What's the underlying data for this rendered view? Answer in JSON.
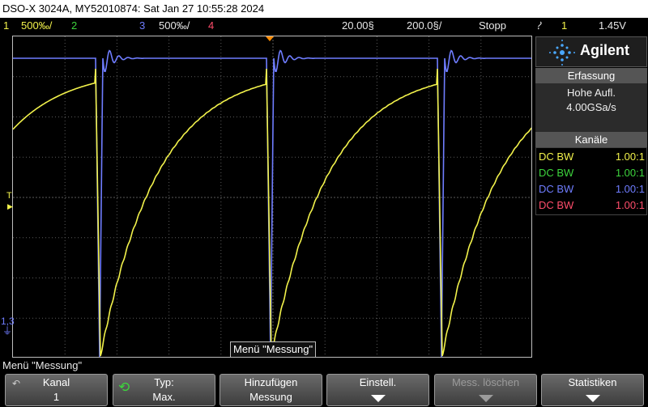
{
  "window": {
    "title": "DSO-X 3024A, MY52010874: Sat Jan 27 10:55:28 2024"
  },
  "status": {
    "ch1_num": "1",
    "ch1_scale": "500‰/",
    "ch2_num": "2",
    "ch3_num": "3",
    "ch3_scale": "500‰/",
    "ch4_num": "4",
    "timebase_delay": "20.00§",
    "timebase_scale": "200.0§/",
    "run_state": "Stopp",
    "trigger_symbol": "⹔",
    "trigger_source": "1",
    "trigger_level": "1.45V"
  },
  "side_panel": {
    "brand": "Agilent",
    "acq_header": "Erfassung",
    "acq_mode": "Hohe Aufl.",
    "acq_rate": "4.00GSa/s",
    "chan_header": "Kanäle",
    "channels": [
      {
        "coupling": "DC BW",
        "ratio": "1.00:1",
        "color": "#f2f24b"
      },
      {
        "coupling": "DC BW",
        "ratio": "1.00:1",
        "color": "#3dd43d"
      },
      {
        "coupling": "DC BW",
        "ratio": "1.00:1",
        "color": "#6f7dff"
      },
      {
        "coupling": "DC BW",
        "ratio": "1.00:1",
        "color": "#ff4d6b"
      }
    ]
  },
  "screen": {
    "trigger_marker": "T",
    "ch_marker": "1,3",
    "menu_overlay": "Menü \"Messung\""
  },
  "message_bar": "Menü \"Messung\"",
  "softkeys": [
    {
      "line1": "Kanal",
      "line2": "1"
    },
    {
      "line1": "Typ:",
      "line2": "Max."
    },
    {
      "line1": "Hinzufügen",
      "line2": "Messung"
    },
    {
      "line1": "Einstell.",
      "line2": ""
    },
    {
      "line1": "Mess. löschen",
      "line2": ""
    },
    {
      "line1": "Statistiken",
      "line2": ""
    }
  ],
  "colors": {
    "ch1": "#f2f24b",
    "ch3": "#6f7dff",
    "trigger_marker": "#ff8c00",
    "grid": "#5a5a5a"
  }
}
